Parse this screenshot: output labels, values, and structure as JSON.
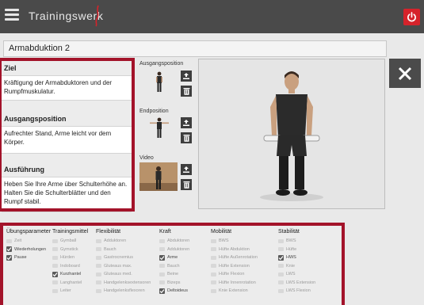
{
  "header": {
    "app_name": "Trainingswerk"
  },
  "exercise": {
    "title": "Armabduktion 2"
  },
  "details": {
    "ziel_heading": "Ziel",
    "ziel_text": "Kräftigung der Armabduktoren und der Rumpfmuskulatur.",
    "ausgangsposition_heading": "Ausgangsposition",
    "ausgangsposition_text": "Aufrechter Stand, Arme leicht vor dem Körper.",
    "ausfuehrung_heading": "Ausführung",
    "ausfuehrung_text": "Heben Sie Ihre Arme über Schulterhöhe an. Halten Sie die Schulterblätter und den Rumpf stabil."
  },
  "media": {
    "ausgangsposition_label": "Ausgangsposition",
    "endposition_label": "Endposition",
    "video_label": "Video"
  },
  "categories": [
    {
      "title": "Übungsparameter",
      "options": [
        {
          "label": "Zeit",
          "checked": false
        },
        {
          "label": "Wiederholungen",
          "checked": true
        },
        {
          "label": "Pause",
          "checked": true
        }
      ]
    },
    {
      "title": "Trainingsmittel",
      "options": [
        {
          "label": "Gymball",
          "checked": false
        },
        {
          "label": "Gymstick",
          "checked": false
        },
        {
          "label": "Hürden",
          "checked": false
        },
        {
          "label": "Indoboard",
          "checked": false
        },
        {
          "label": "Kurzhantel",
          "checked": true
        },
        {
          "label": "Langhantel",
          "checked": false
        },
        {
          "label": "Leiter",
          "checked": false
        }
      ]
    },
    {
      "title": "Flexibilität",
      "options": [
        {
          "label": "Adduktoren",
          "checked": false
        },
        {
          "label": "Bauch",
          "checked": false
        },
        {
          "label": "Gastrocnemius",
          "checked": false
        },
        {
          "label": "Gluteaus max.",
          "checked": false
        },
        {
          "label": "Gluteaus med.",
          "checked": false
        },
        {
          "label": "Handgelenksextensoren",
          "checked": false
        },
        {
          "label": "Handgelenksflexoren",
          "checked": false
        }
      ]
    },
    {
      "title": "Kraft",
      "options": [
        {
          "label": "Abduktoren",
          "checked": false
        },
        {
          "label": "Adduktoren",
          "checked": false
        },
        {
          "label": "Arme",
          "checked": true
        },
        {
          "label": "Bauch",
          "checked": false
        },
        {
          "label": "Beine",
          "checked": false
        },
        {
          "label": "Bizeps",
          "checked": false
        },
        {
          "label": "Deltoideus",
          "checked": true
        }
      ]
    },
    {
      "title": "Mobilität",
      "options": [
        {
          "label": "BWS",
          "checked": false
        },
        {
          "label": "Hüfte Abduktion",
          "checked": false
        },
        {
          "label": "Hüfte Außenrotation",
          "checked": false
        },
        {
          "label": "Hüfte Extension",
          "checked": false
        },
        {
          "label": "Hüfte Flexion",
          "checked": false
        },
        {
          "label": "Hüfte Innenrotation",
          "checked": false
        },
        {
          "label": "Knie Extension",
          "checked": false
        }
      ]
    },
    {
      "title": "Stabilität",
      "options": [
        {
          "label": "BWS",
          "checked": false
        },
        {
          "label": "Hüfte",
          "checked": false
        },
        {
          "label": "HWS",
          "checked": true
        },
        {
          "label": "Knie",
          "checked": false
        },
        {
          "label": "LWS",
          "checked": false
        },
        {
          "label": "LWS Extension",
          "checked": false
        },
        {
          "label": "LWS Flexion",
          "checked": false
        }
      ]
    }
  ]
}
